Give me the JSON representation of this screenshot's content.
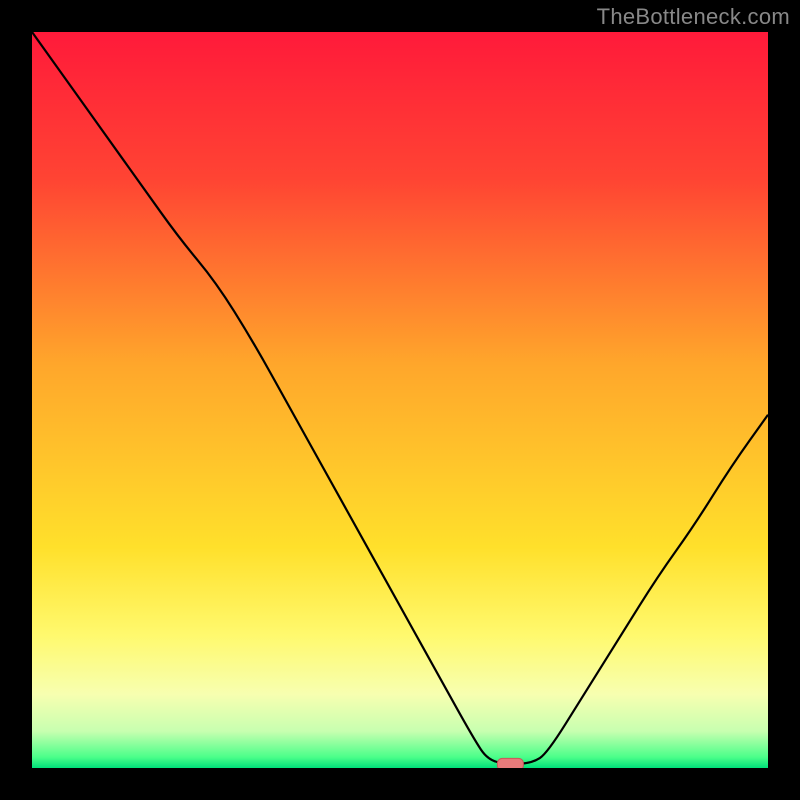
{
  "watermark": "TheBottleneck.com",
  "chart_data": {
    "type": "line",
    "title": "",
    "xlabel": "",
    "ylabel": "",
    "xlim": [
      0,
      100
    ],
    "ylim": [
      0,
      100
    ],
    "grid": false,
    "legend": false,
    "series": [
      {
        "name": "bottleneck-curve",
        "x": [
          0,
          5,
          10,
          15,
          20,
          25,
          30,
          35,
          40,
          45,
          50,
          55,
          60,
          62,
          65,
          68,
          70,
          75,
          80,
          85,
          90,
          95,
          100
        ],
        "y": [
          100,
          93,
          86,
          79,
          72,
          66,
          58,
          49,
          40,
          31,
          22,
          13,
          4,
          1,
          0.5,
          0.7,
          2,
          10,
          18,
          26,
          33,
          41,
          48
        ]
      }
    ],
    "optimal_marker": {
      "x": 65,
      "y": 0.5
    },
    "background": {
      "type": "vertical-gradient",
      "stops": [
        {
          "pos": 0.0,
          "color": "#ff1a3a"
        },
        {
          "pos": 0.2,
          "color": "#ff4433"
        },
        {
          "pos": 0.45,
          "color": "#ffa62b"
        },
        {
          "pos": 0.7,
          "color": "#ffe02b"
        },
        {
          "pos": 0.82,
          "color": "#fff96e"
        },
        {
          "pos": 0.9,
          "color": "#f7ffb0"
        },
        {
          "pos": 0.95,
          "color": "#c8ffb0"
        },
        {
          "pos": 0.985,
          "color": "#4cff8a"
        },
        {
          "pos": 1.0,
          "color": "#00e07a"
        }
      ]
    },
    "colors": {
      "curve": "#000000",
      "marker_fill": "#e77a7a",
      "marker_stroke": "#c95858"
    }
  }
}
